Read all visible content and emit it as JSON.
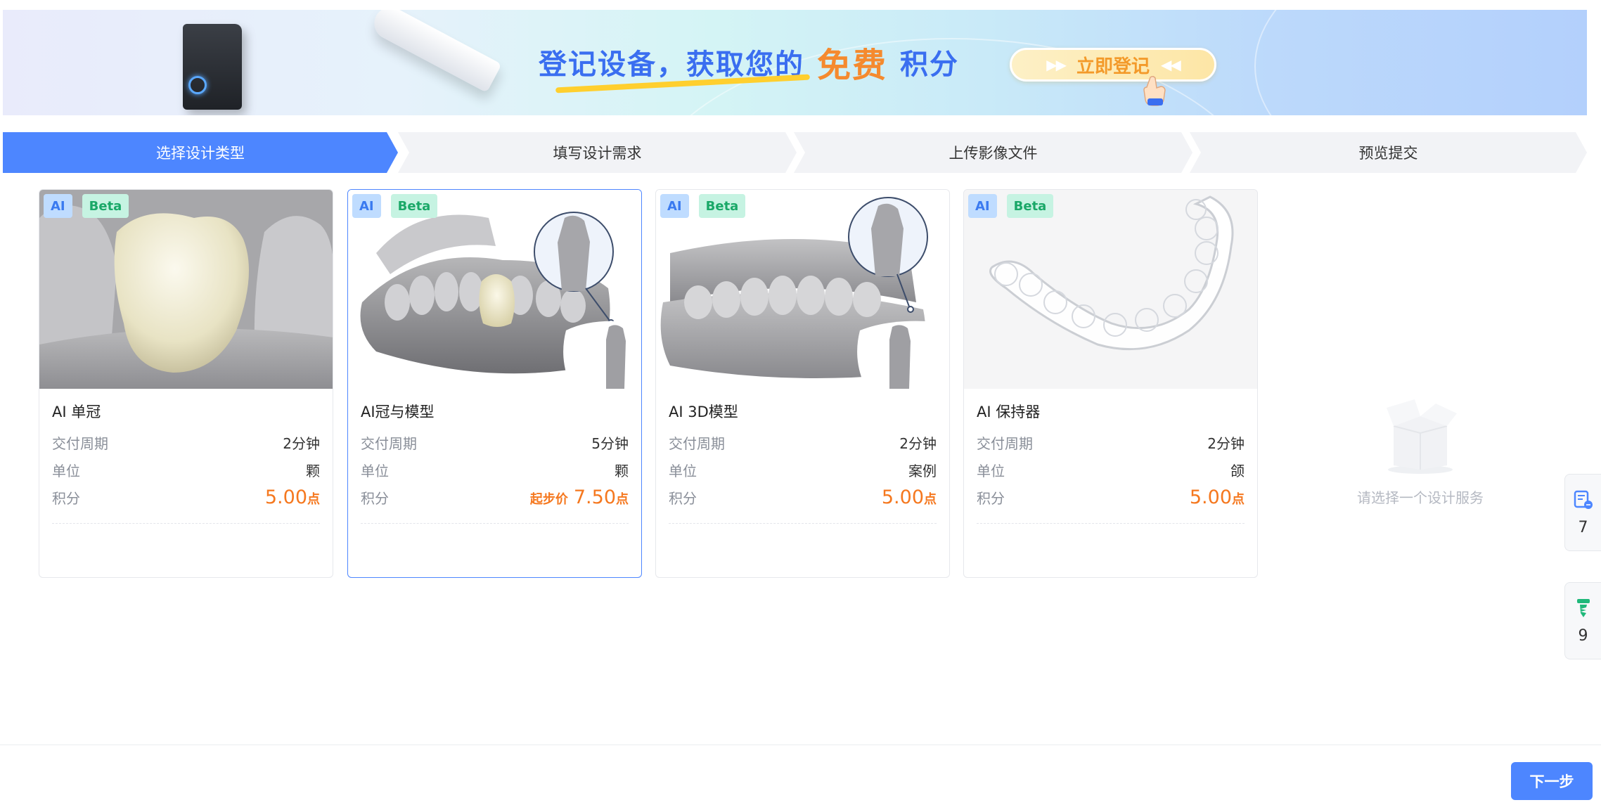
{
  "banner": {
    "title_part1": "登记设备，获取您的",
    "title_free": "免费",
    "title_part2": "积分",
    "register_label": "立即登记"
  },
  "steps": [
    {
      "label": "选择设计类型",
      "active": true
    },
    {
      "label": "填写设计需求",
      "active": false
    },
    {
      "label": "上传影像文件",
      "active": false
    },
    {
      "label": "预览提交",
      "active": false
    }
  ],
  "cards": [
    {
      "tag_ai": "AI",
      "tag_beta": "Beta",
      "title": "AI 单冠",
      "period_label": "交付周期",
      "period": "2分钟",
      "unit_label": "单位",
      "unit": "颗",
      "points_label": "积分",
      "price_prefix": "",
      "price": "5.00",
      "price_unit": "点",
      "selected": false
    },
    {
      "tag_ai": "AI",
      "tag_beta": "Beta",
      "title": "AI冠与模型",
      "period_label": "交付周期",
      "period": "5分钟",
      "unit_label": "单位",
      "unit": "颗",
      "points_label": "积分",
      "price_prefix": "起步价",
      "price": "7.50",
      "price_unit": "点",
      "selected": true
    },
    {
      "tag_ai": "AI",
      "tag_beta": "Beta",
      "title": "AI 3D模型",
      "period_label": "交付周期",
      "period": "2分钟",
      "unit_label": "单位",
      "unit": "案例",
      "points_label": "积分",
      "price_prefix": "",
      "price": "5.00",
      "price_unit": "点",
      "selected": false
    },
    {
      "tag_ai": "AI",
      "tag_beta": "Beta",
      "title": "AI 保持器",
      "period_label": "交付周期",
      "period": "2分钟",
      "unit_label": "单位",
      "unit": "颌",
      "points_label": "积分",
      "price_prefix": "",
      "price": "5.00",
      "price_unit": "点",
      "selected": false
    }
  ],
  "empty_state": {
    "text": "请选择一个设计服务"
  },
  "side_widgets": [
    {
      "icon": "device-list-icon",
      "count": "7"
    },
    {
      "icon": "implant-screw-icon",
      "count": "9"
    }
  ],
  "footer": {
    "next_label": "下一步"
  },
  "colors": {
    "primary": "#4d86ff",
    "price": "#f5781f",
    "ai_tag": "#3a7af0",
    "beta_tag": "#1aa868"
  }
}
